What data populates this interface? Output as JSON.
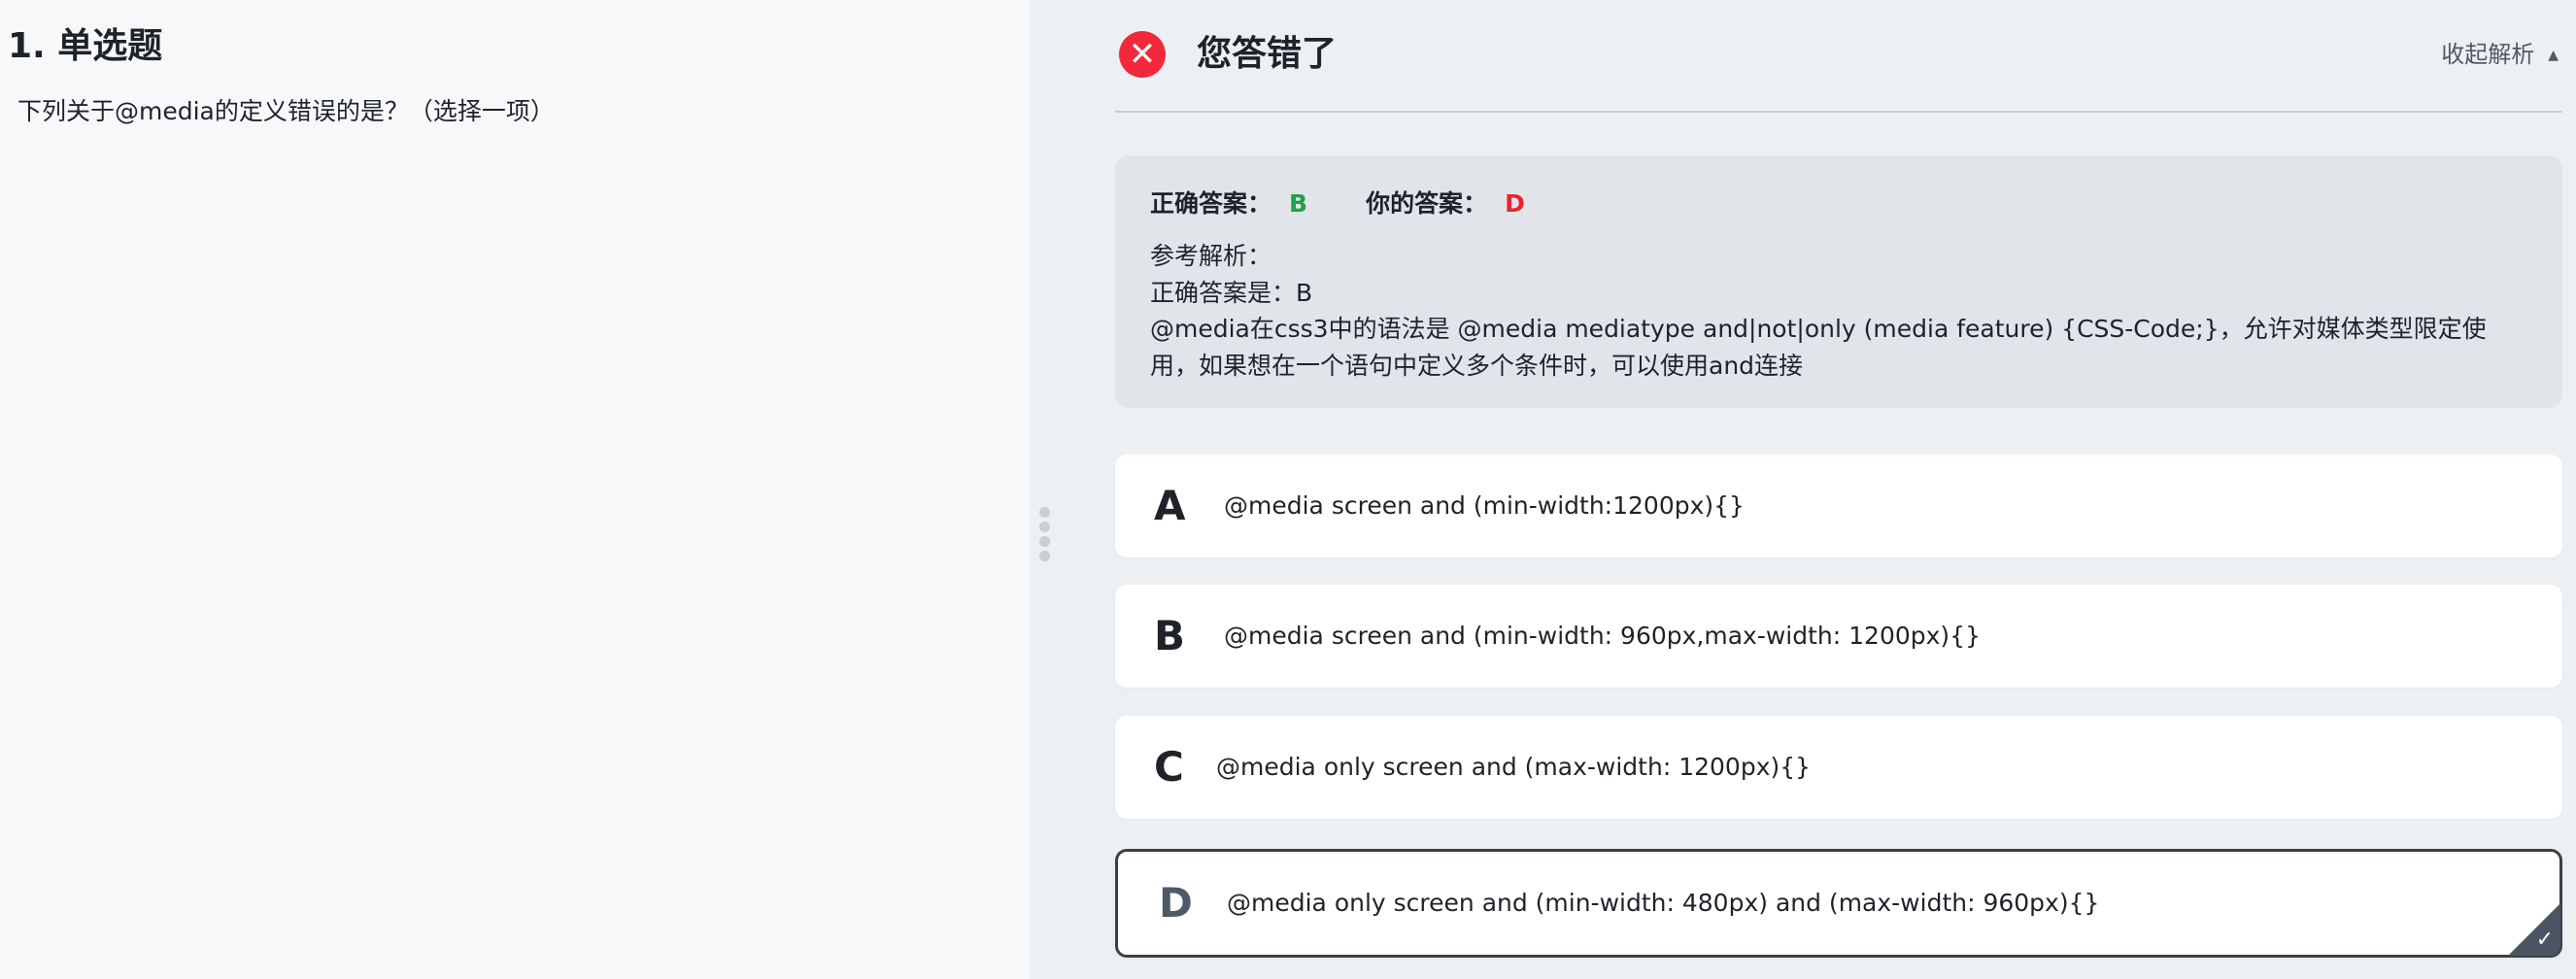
{
  "question": {
    "title": "1. 单选题",
    "text": "下列关于@media的定义错误的是？（选择一项）"
  },
  "result": {
    "title": "您答错了",
    "collapse_label": "收起解析",
    "status_color": "#f2293a"
  },
  "analysis": {
    "correct_label": "正确答案：",
    "correct_value": "B",
    "your_label": "你的答案：",
    "your_value": "D",
    "ref_label": "参考解析：",
    "ref_line1": "正确答案是：B",
    "ref_body": "@media在css3中的语法是 @media mediatype  and|not|only (media feature) {CSS-Code;}，允许对媒体类型限定使用，如果想在一个语句中定义多个条件时，可以使用and连接"
  },
  "options": [
    {
      "letter": "A",
      "text": "@media screen and (min-width:1200px){}"
    },
    {
      "letter": "B",
      "text": "@media screen and (min-width: 960px,max-width: 1200px){}"
    },
    {
      "letter": "C",
      "text": "@media only screen and (max-width: 1200px){}"
    },
    {
      "letter": "D",
      "text": "@media only screen and (min-width: 480px) and (max-width: 960px){}",
      "selected": true
    }
  ],
  "colors": {
    "correct": "#22a04a",
    "wrong": "#e8242b"
  }
}
